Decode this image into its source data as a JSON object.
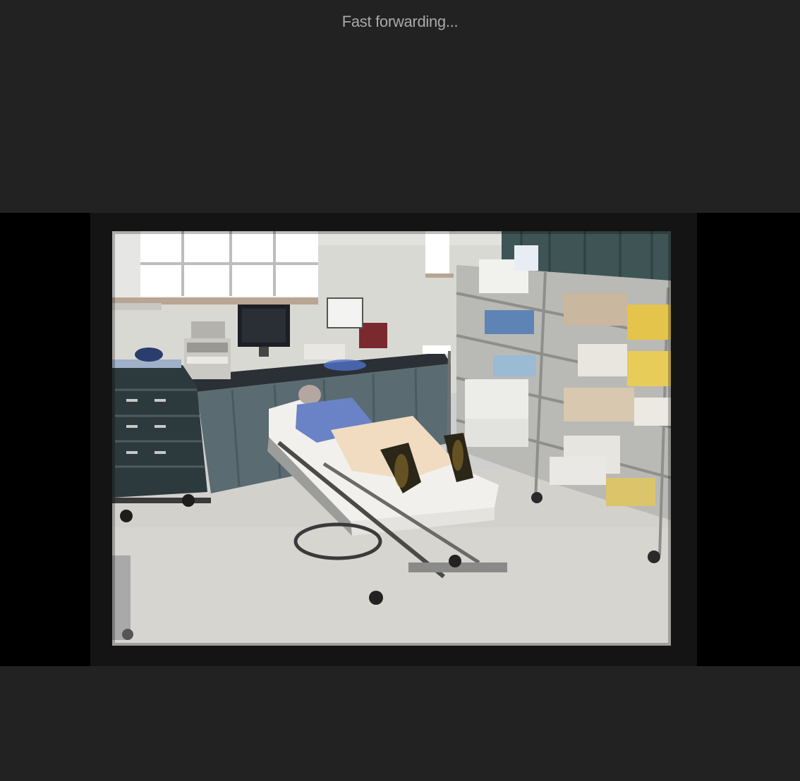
{
  "player": {
    "status_text": "Fast forwarding..."
  },
  "colors": {
    "page_background": "#222222",
    "letterbox": "#000000",
    "frame_border": "#141414",
    "status_text": "#a9a9a9"
  },
  "video": {
    "icon": "hospital-room-video-frame"
  }
}
